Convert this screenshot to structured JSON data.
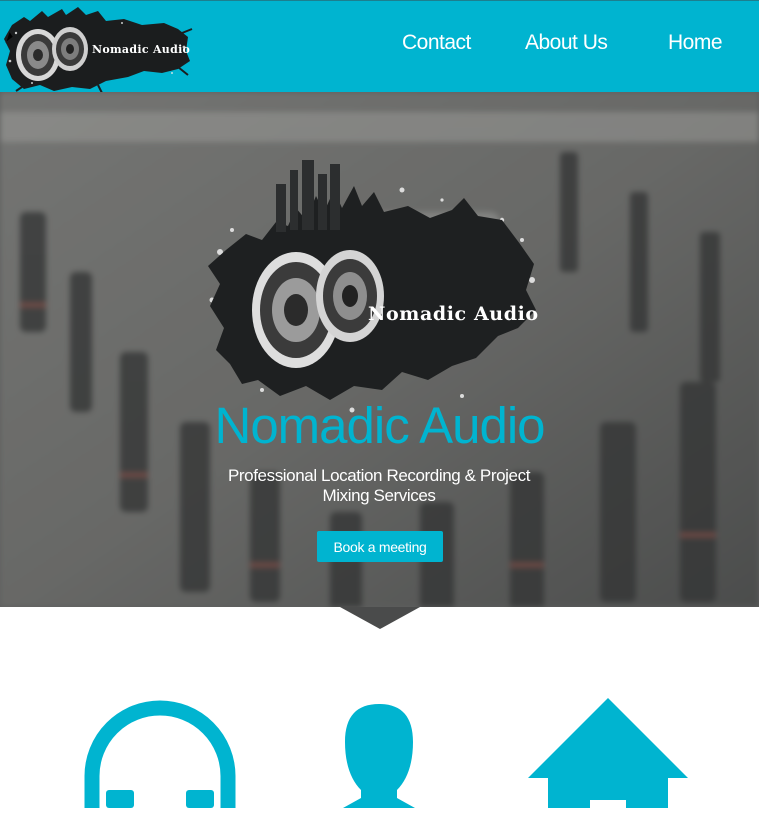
{
  "header": {
    "logo_text": "Nomadic Audio"
  },
  "nav": {
    "items": [
      {
        "label": "Contact"
      },
      {
        "label": "About Us"
      },
      {
        "label": "Home"
      }
    ]
  },
  "hero": {
    "logo_text": "Nomadic Audio",
    "title": "Nomadic Audio",
    "subtitle_line1": "Professional Location Recording & Project",
    "subtitle_line2": "Mixing Services",
    "cta_label": "Book a meeting"
  },
  "features": {
    "icons": [
      "headphones-icon",
      "person-icon",
      "house-icon"
    ]
  },
  "colors": {
    "accent": "#00b4d0",
    "white": "#ffffff",
    "hero_overlay": "#4a4b4b"
  }
}
